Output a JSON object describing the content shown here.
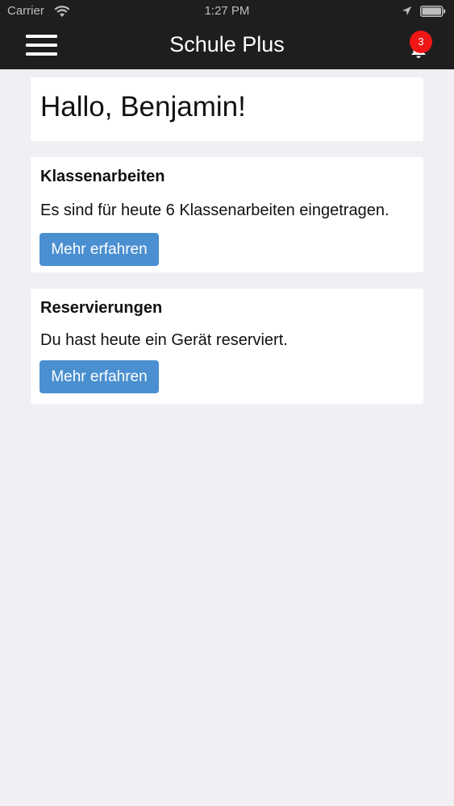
{
  "status_bar": {
    "carrier": "Carrier",
    "time": "1:27 PM"
  },
  "nav": {
    "title": "Schule Plus",
    "menu_icon": "hamburger-menu-icon",
    "bell_icon": "bell-icon",
    "notification_count": "3"
  },
  "greeting": "Hallo, Benjamin!",
  "cards": [
    {
      "title": "Klassenarbeiten",
      "text": "Es sind für heute 6 Klassenarbeiten eingetragen.",
      "button_label": "Mehr erfahren"
    },
    {
      "title": "Reservierungen",
      "text": "Du hast heute ein Gerät reserviert.",
      "button_label": "Mehr erfahren"
    }
  ],
  "colors": {
    "nav_background": "#1e1e1e",
    "page_background": "#efeff4",
    "button_background": "#4a8fd0",
    "badge_background": "#f01616"
  }
}
